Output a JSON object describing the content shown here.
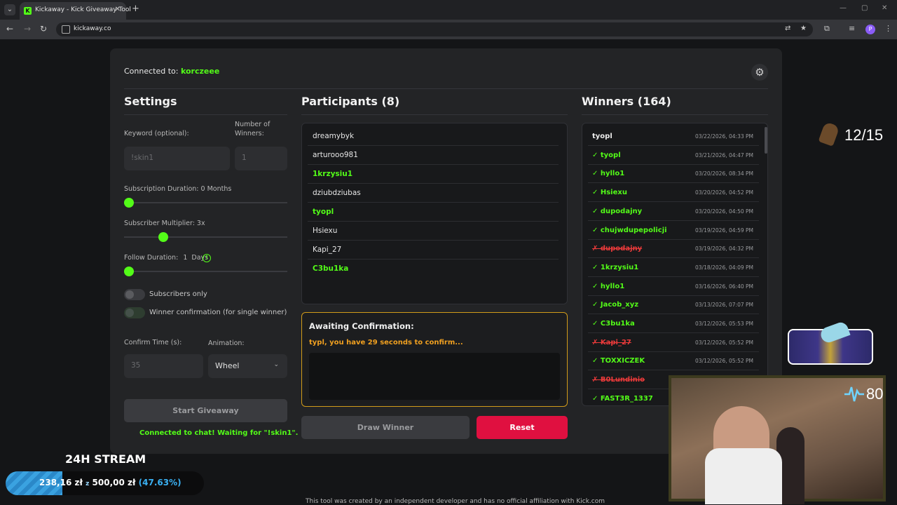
{
  "browser": {
    "tab_title": "Kickaway - Kick Giveaway Tool",
    "url": "kickaway.co",
    "profile_initial": "P"
  },
  "header": {
    "connected_label": "Connected to: ",
    "channel": "korczeee"
  },
  "settings": {
    "title": "Settings",
    "keyword_label": "Keyword (optional):",
    "keyword_placeholder": "!skin1",
    "winners_label_1": "Number of",
    "winners_label_2": "Winners:",
    "winners_placeholder": "1",
    "sub_duration_label": "Subscription Duration: 0 Months",
    "sub_duration_value": 0,
    "sub_multiplier_label": "Subscriber Multiplier: 3x",
    "sub_multiplier_value": 0.24,
    "follow_duration_label": "Follow Duration:",
    "follow_duration_days": "1",
    "follow_duration_unit": "Days",
    "follow_info": "!",
    "subscribers_only_label": "Subscribers only",
    "subscribers_only": false,
    "winner_confirmation_label": "Winner confirmation (for single winner)",
    "winner_confirmation": true,
    "confirm_time_label": "Confirm Time (s):",
    "confirm_time_placeholder": "35",
    "animation_label": "Animation:",
    "animation_value": "Wheel",
    "start_button": "Start Giveaway",
    "status": "Connected to chat! Waiting for \"!skin1\"."
  },
  "participants": {
    "title": "Participants (8)",
    "items": [
      {
        "name": "dreamybyk",
        "subscriber": false
      },
      {
        "name": "arturooo981",
        "subscriber": false
      },
      {
        "name": "1krzysiu1",
        "subscriber": true
      },
      {
        "name": "dziubdziubas",
        "subscriber": false
      },
      {
        "name": "tyopl",
        "subscriber": true
      },
      {
        "name": "Hsiexu",
        "subscriber": false
      },
      {
        "name": "Kapi_27",
        "subscriber": false
      },
      {
        "name": "C3bu1ka",
        "subscriber": true
      }
    ],
    "await_title": "Awaiting Confirmation:",
    "await_message": "typl, you have 29 seconds to confirm...",
    "draw_button": "Draw Winner",
    "reset_button": "Reset"
  },
  "winners": {
    "title": "Winners (164)",
    "items": [
      {
        "name": "tyopl",
        "date": "03/22/2026, 04:33 PM",
        "status": "plain"
      },
      {
        "name": "✓ tyopl",
        "date": "03/21/2026, 04:47 PM",
        "status": "ok"
      },
      {
        "name": "✓ hyllo1",
        "date": "03/20/2026, 08:34 PM",
        "status": "ok"
      },
      {
        "name": "✓ Hsiexu",
        "date": "03/20/2026, 04:52 PM",
        "status": "ok"
      },
      {
        "name": "✓ dupodajny",
        "date": "03/20/2026, 04:50 PM",
        "status": "ok"
      },
      {
        "name": "✓ chujwdupepolicji",
        "date": "03/19/2026, 04:59 PM",
        "status": "ok"
      },
      {
        "name": "✗ dupodajny",
        "date": "03/19/2026, 04:32 PM",
        "status": "bad"
      },
      {
        "name": "✓ 1krzysiu1",
        "date": "03/18/2026, 04:09 PM",
        "status": "ok"
      },
      {
        "name": "✓ hyllo1",
        "date": "03/16/2026, 06:40 PM",
        "status": "ok"
      },
      {
        "name": "✓ Jacob_xyz",
        "date": "03/13/2026, 07:07 PM",
        "status": "ok"
      },
      {
        "name": "✓ C3bu1ka",
        "date": "03/12/2026, 05:53 PM",
        "status": "ok"
      },
      {
        "name": "✗ Kapi_27",
        "date": "03/12/2026, 05:52 PM",
        "status": "bad"
      },
      {
        "name": "✓ TOXXICZEK",
        "date": "03/12/2026, 05:52 PM",
        "status": "ok"
      },
      {
        "name": "✗ B0Lundinio",
        "date": "",
        "status": "bad"
      },
      {
        "name": "✓ FAST3R_1337",
        "date": "",
        "status": "ok"
      }
    ]
  },
  "overlay": {
    "stream_title": "24H STREAM",
    "progress_current": "238,16 zł",
    "progress_sep": "z",
    "progress_goal": "500,00 zł",
    "progress_pct": "(47.63%)",
    "progress_fraction": 0.4763,
    "counter": "12/15",
    "heart_rate": "80"
  },
  "footer": "This tool was created by an independent developer and has no official affiliation with Kick.com",
  "colors": {
    "accent": "#53fc18",
    "danger": "#ea3a3a",
    "reset": "#e01040",
    "await_border": "#d19b1a"
  }
}
